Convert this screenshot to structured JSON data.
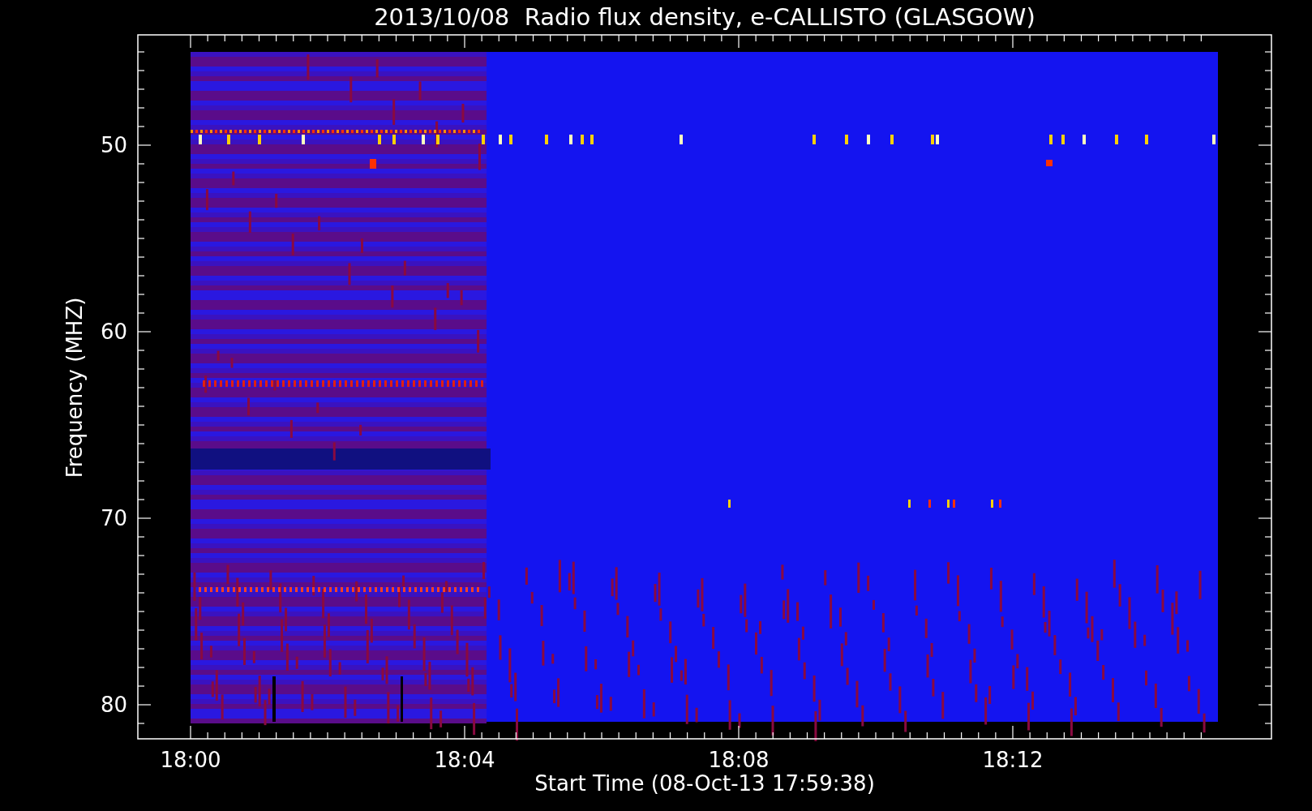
{
  "plot": {
    "title": "2013/10/08  Radio flux density, e-CALLISTO (GLASGOW)",
    "xlabel": "Start Time (08-Oct-13 17:59:38)",
    "ylabel": "Frequency (MHZ)",
    "yticks": [
      "50",
      "60",
      "70",
      "80"
    ],
    "xticks": [
      "18:00",
      "18:04",
      "18:08",
      "18:12"
    ]
  }
}
